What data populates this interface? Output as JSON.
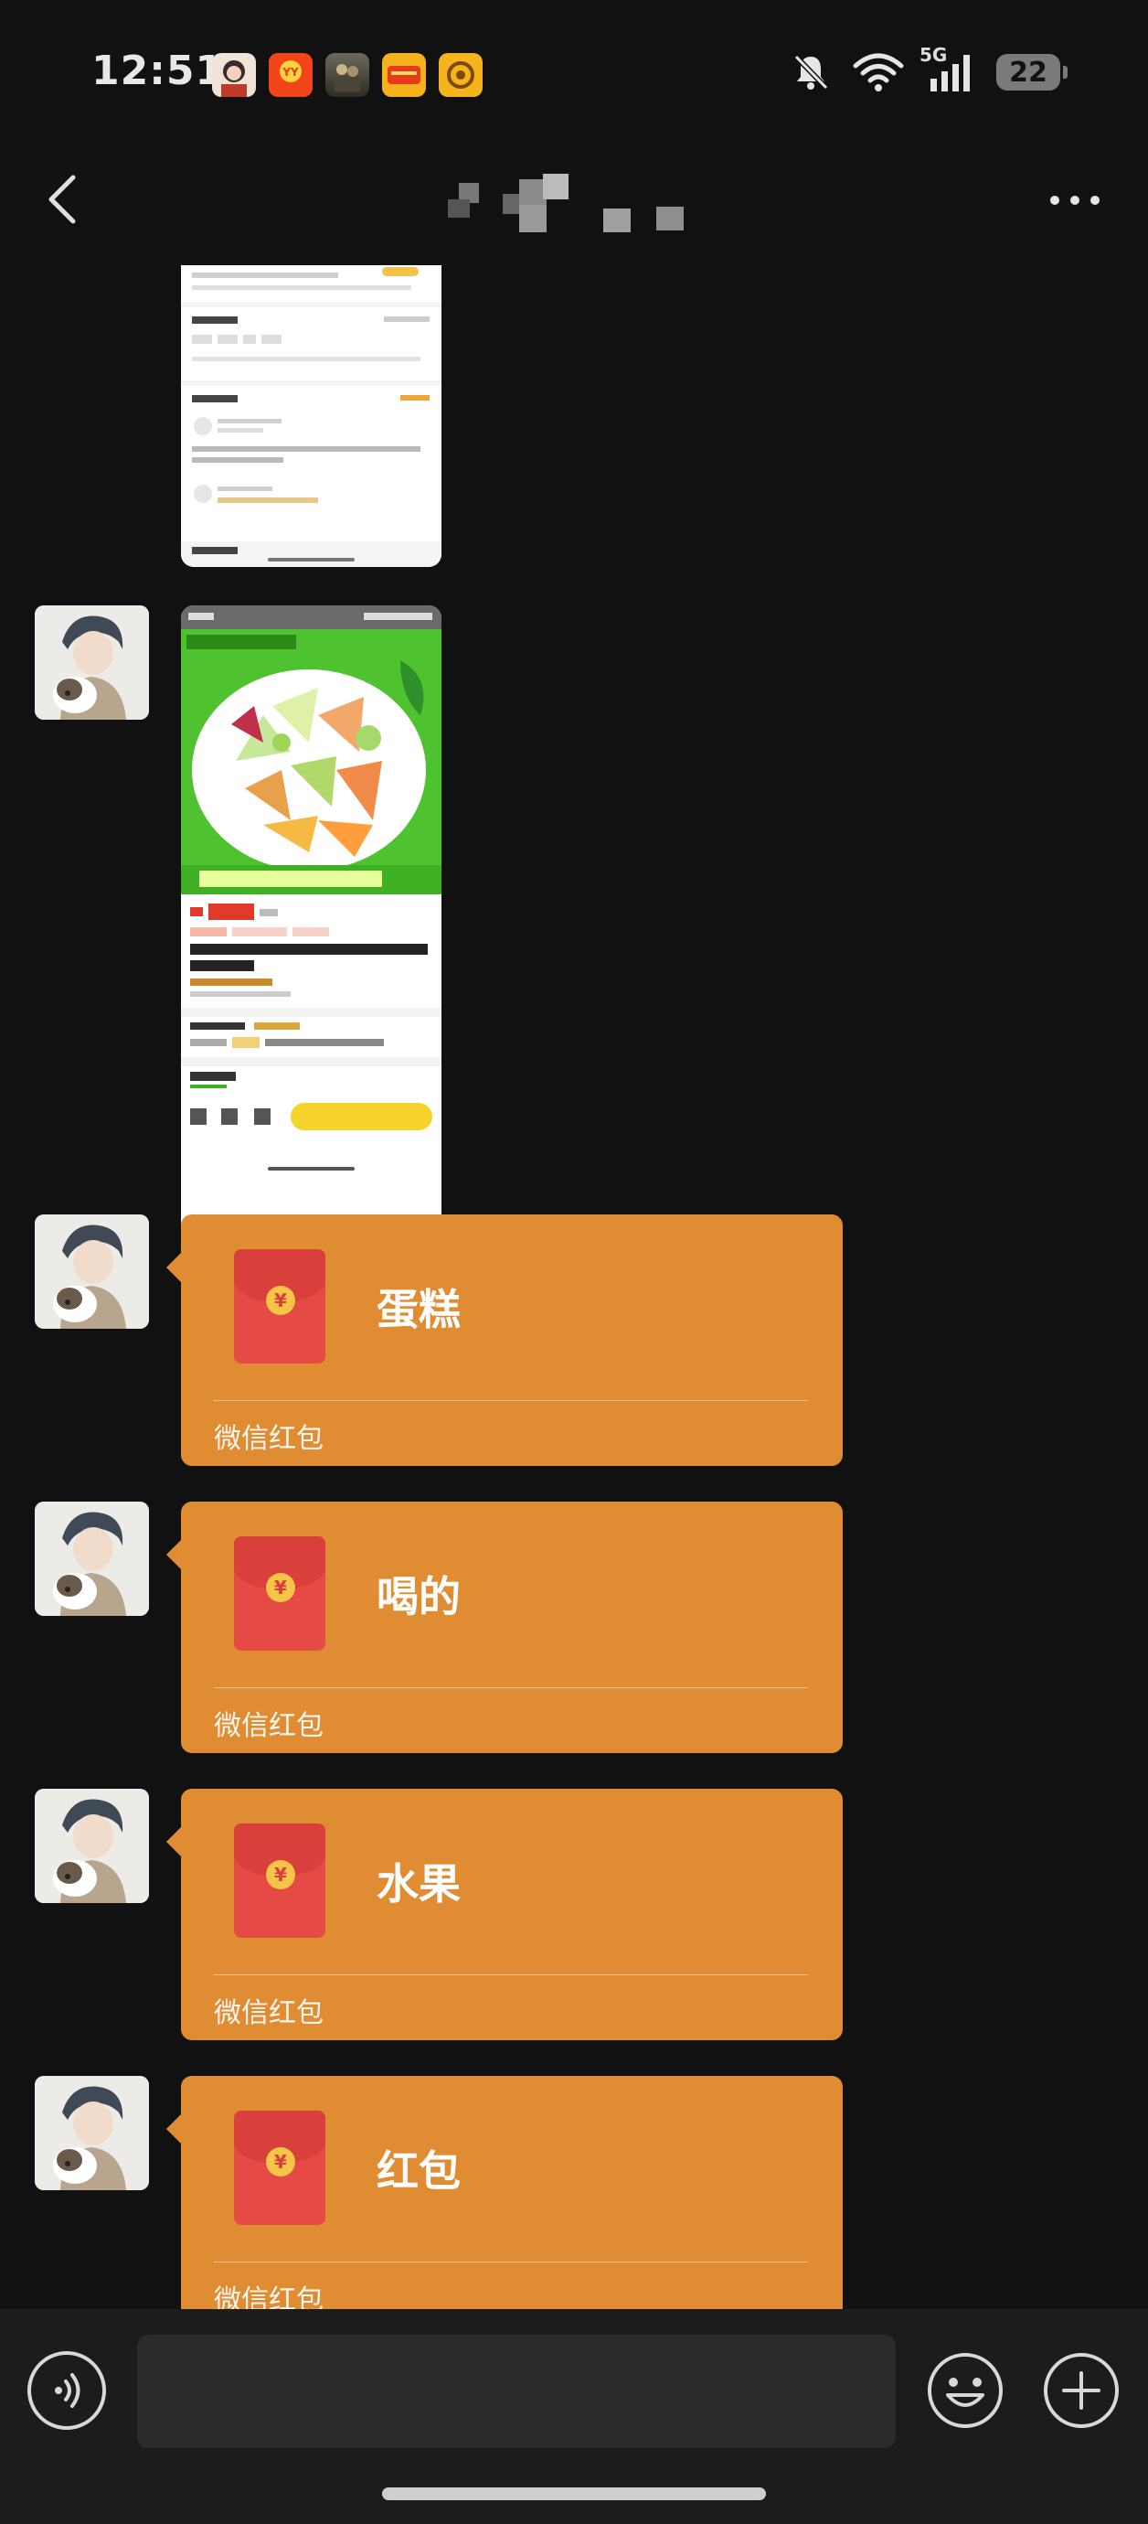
{
  "status_bar": {
    "time": "12:51",
    "network_label": "5G",
    "battery": "22",
    "app_icons": [
      "contact-avatar-icon",
      "shopping-app-icon",
      "game-app-icon",
      "news-app-icon",
      "music-app-icon"
    ],
    "system_icons": [
      "mute-bell-icon",
      "wifi-icon",
      "signal-icon",
      "battery-icon"
    ]
  },
  "nav": {
    "title": "",
    "back_icon": "chevron-left-icon",
    "more_icon": "more-dots-icon"
  },
  "messages": [
    {
      "type": "image",
      "image_name": "product-detail-screenshot"
    },
    {
      "type": "image",
      "image_name": "fruit-product-screenshot"
    },
    {
      "type": "red_packet",
      "title": "蛋糕",
      "footer": "微信红包"
    },
    {
      "type": "red_packet",
      "title": "喝的",
      "footer": "微信红包"
    },
    {
      "type": "red_packet",
      "title": "水果",
      "footer": "微信红包"
    },
    {
      "type": "red_packet",
      "title": "红包",
      "footer": "微信红包"
    }
  ],
  "input": {
    "placeholder": "",
    "value": ""
  },
  "colors": {
    "background": "#111111",
    "red_packet": "#e08c33",
    "envelope": "#e64a45",
    "coin": "#f6c547",
    "bottom_bar": "#1c1c1c"
  }
}
